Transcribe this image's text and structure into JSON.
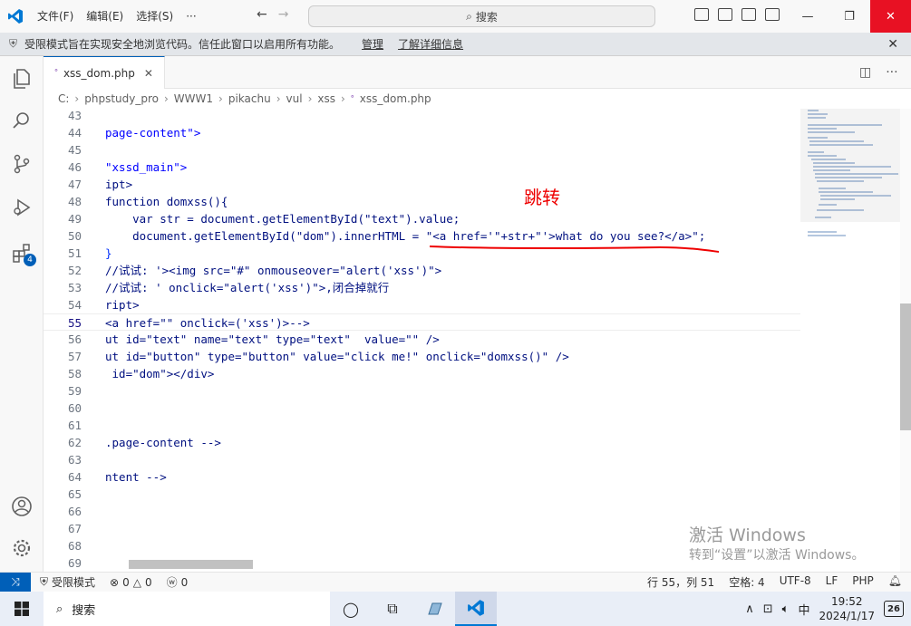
{
  "menu": {
    "file": "文件(F)",
    "edit": "编辑(E)",
    "select": "选择(S)",
    "more": "···"
  },
  "search": {
    "label": "搜索"
  },
  "banner": {
    "text": "受限模式旨在实现安全地浏览代码。信任此窗口以启用所有功能。",
    "manage": "管理",
    "learn_more": "了解详细信息"
  },
  "tab": {
    "label": "xss_dom.php"
  },
  "breadcrumb": [
    "C:",
    "phpstudy_pro",
    "WWW1",
    "pikachu",
    "vul",
    "xss",
    "xss_dom.php"
  ],
  "lines": [
    {
      "n": "43",
      "code": ""
    },
    {
      "n": "44",
      "code": "page-content\">"
    },
    {
      "n": "45",
      "code": ""
    },
    {
      "n": "46",
      "code": "\"xssd_main\">"
    },
    {
      "n": "47",
      "code": "ipt>"
    },
    {
      "n": "48",
      "code": "function domxss(){"
    },
    {
      "n": "49",
      "code": "    var str = document.getElementById(\"text\").value;"
    },
    {
      "n": "50",
      "code": "    document.getElementById(\"dom\").innerHTML = \"<a href='\"+str+\"'>what do you see?</a>\";"
    },
    {
      "n": "51",
      "code": "}"
    },
    {
      "n": "52",
      "code": "//试试: '><img src=\"#\" onmouseover=\"alert('xss')\">"
    },
    {
      "n": "53",
      "code": "//试试: ' onclick=\"alert('xss')\">,闭合掉就行"
    },
    {
      "n": "54",
      "code": "ript>"
    },
    {
      "n": "55",
      "code": "<a href=\"\" onclick=('xss')>-->"
    },
    {
      "n": "56",
      "code": "ut id=\"text\" name=\"text\" type=\"text\"  value=\"\" />"
    },
    {
      "n": "57",
      "code": "ut id=\"button\" type=\"button\" value=\"click me!\" onclick=\"domxss()\" />"
    },
    {
      "n": "58",
      "code": " id=\"dom\"></div>"
    },
    {
      "n": "59",
      "code": ""
    },
    {
      "n": "60",
      "code": ""
    },
    {
      "n": "61",
      "code": ""
    },
    {
      "n": "62",
      "code": ".page-content -->"
    },
    {
      "n": "63",
      "code": ""
    },
    {
      "n": "64",
      "code": "ntent -->"
    },
    {
      "n": "65",
      "code": ""
    },
    {
      "n": "66",
      "code": ""
    },
    {
      "n": "67",
      "code": ""
    },
    {
      "n": "68",
      "code": ""
    },
    {
      "n": "69",
      "code": ""
    }
  ],
  "annotation": "跳转",
  "watermark": {
    "line1": "激活 Windows",
    "line2": "转到“设置”以激活 Windows。"
  },
  "status": {
    "restricted": "受限模式",
    "errors": "0",
    "warnings": "0",
    "ports": "0",
    "position": "行 55，列 51",
    "spaces": "空格: 4",
    "encoding": "UTF-8",
    "eol": "LF",
    "language": "PHP"
  },
  "taskbar": {
    "search": "搜索",
    "time": "19:52",
    "date": "2024/1/17",
    "ime": "中",
    "notifications": "26"
  },
  "activity_badge": "4",
  "colors": {
    "accent": "#005fb8",
    "close": "#e81123",
    "annotation": "#ee0000"
  }
}
